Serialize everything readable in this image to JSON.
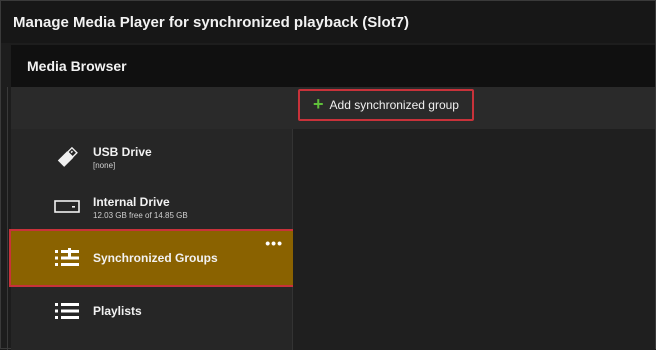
{
  "window": {
    "title": "Manage Media Player for synchronized playback (Slot7)"
  },
  "media_browser": {
    "header": "Media Browser",
    "add_group_label": "Add synchronized group",
    "items": [
      {
        "name": "USB Drive",
        "sub": "[none]",
        "icon": "usb-drive-icon"
      },
      {
        "name": "Internal Drive",
        "sub": "12.03 GB free of 14.85 GB",
        "icon": "hard-drive-icon"
      },
      {
        "name": "Synchronized Groups",
        "sub": "",
        "icon": "sync-groups-icon",
        "selected": true
      },
      {
        "name": "Playlists",
        "sub": "",
        "icon": "playlist-icon"
      }
    ],
    "more_label": "•••"
  },
  "colors": {
    "selected_bg": "#8a6200",
    "highlight_border": "#c8323a",
    "plus_green": "#5fbf3a"
  }
}
